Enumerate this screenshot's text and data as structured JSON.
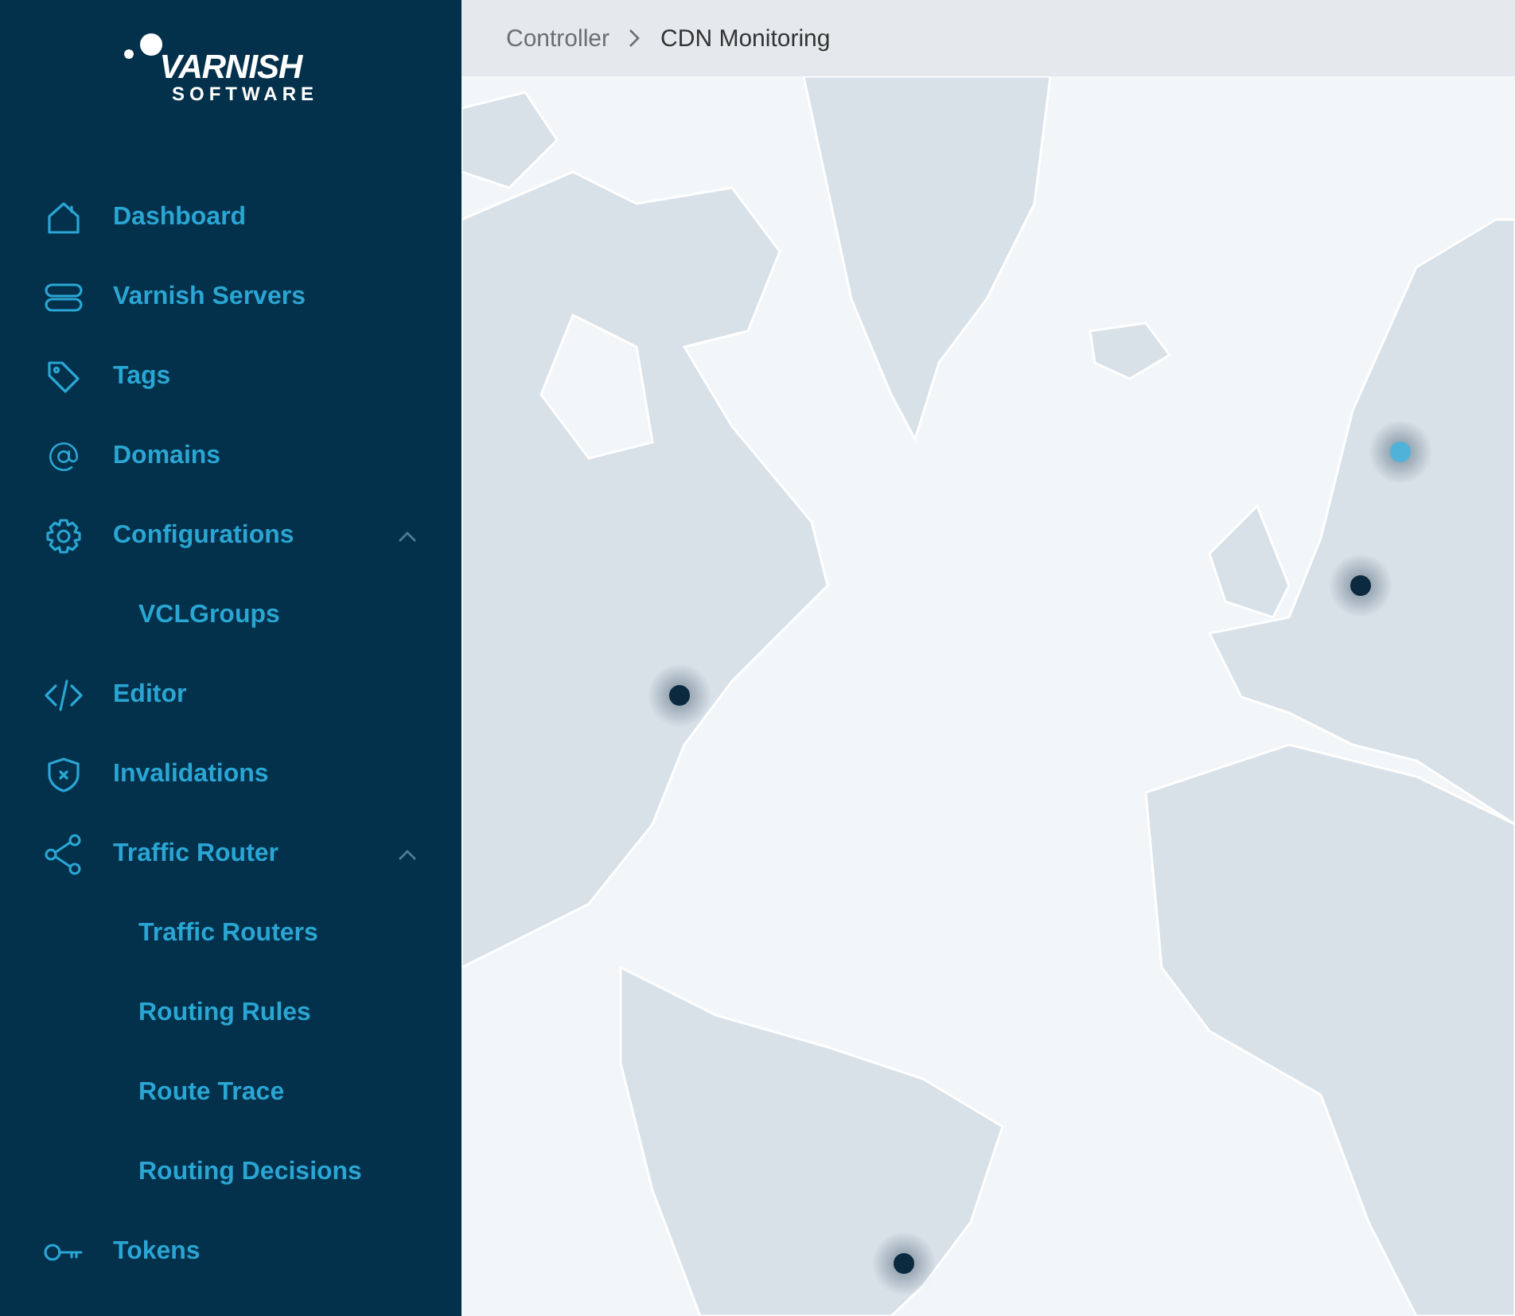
{
  "logo": {
    "name": "VARNISH",
    "subtitle": "SOFTWARE"
  },
  "sidebar": {
    "items": [
      {
        "label": "Dashboard"
      },
      {
        "label": "Varnish Servers"
      },
      {
        "label": "Tags"
      },
      {
        "label": "Domains"
      },
      {
        "label": "Configurations",
        "expanded": true,
        "children": [
          {
            "label": "VCLGroups"
          }
        ]
      },
      {
        "label": "Editor"
      },
      {
        "label": "Invalidations"
      },
      {
        "label": "Traffic Router",
        "expanded": true,
        "children": [
          {
            "label": "Traffic Routers"
          },
          {
            "label": "Routing Rules"
          },
          {
            "label": "Route Trace"
          },
          {
            "label": "Routing Decisions"
          }
        ]
      },
      {
        "label": "Tokens"
      }
    ]
  },
  "breadcrumb": [
    {
      "label": "Controller",
      "selected": false
    },
    {
      "label": "CDN Monitoring",
      "selected": true
    }
  ],
  "map": {
    "markers": [
      {
        "color": "#4fb3d9"
      },
      {
        "color": "#0b2a40"
      },
      {
        "color": "#0b2a40"
      },
      {
        "color": "#0b2a40"
      }
    ]
  }
}
